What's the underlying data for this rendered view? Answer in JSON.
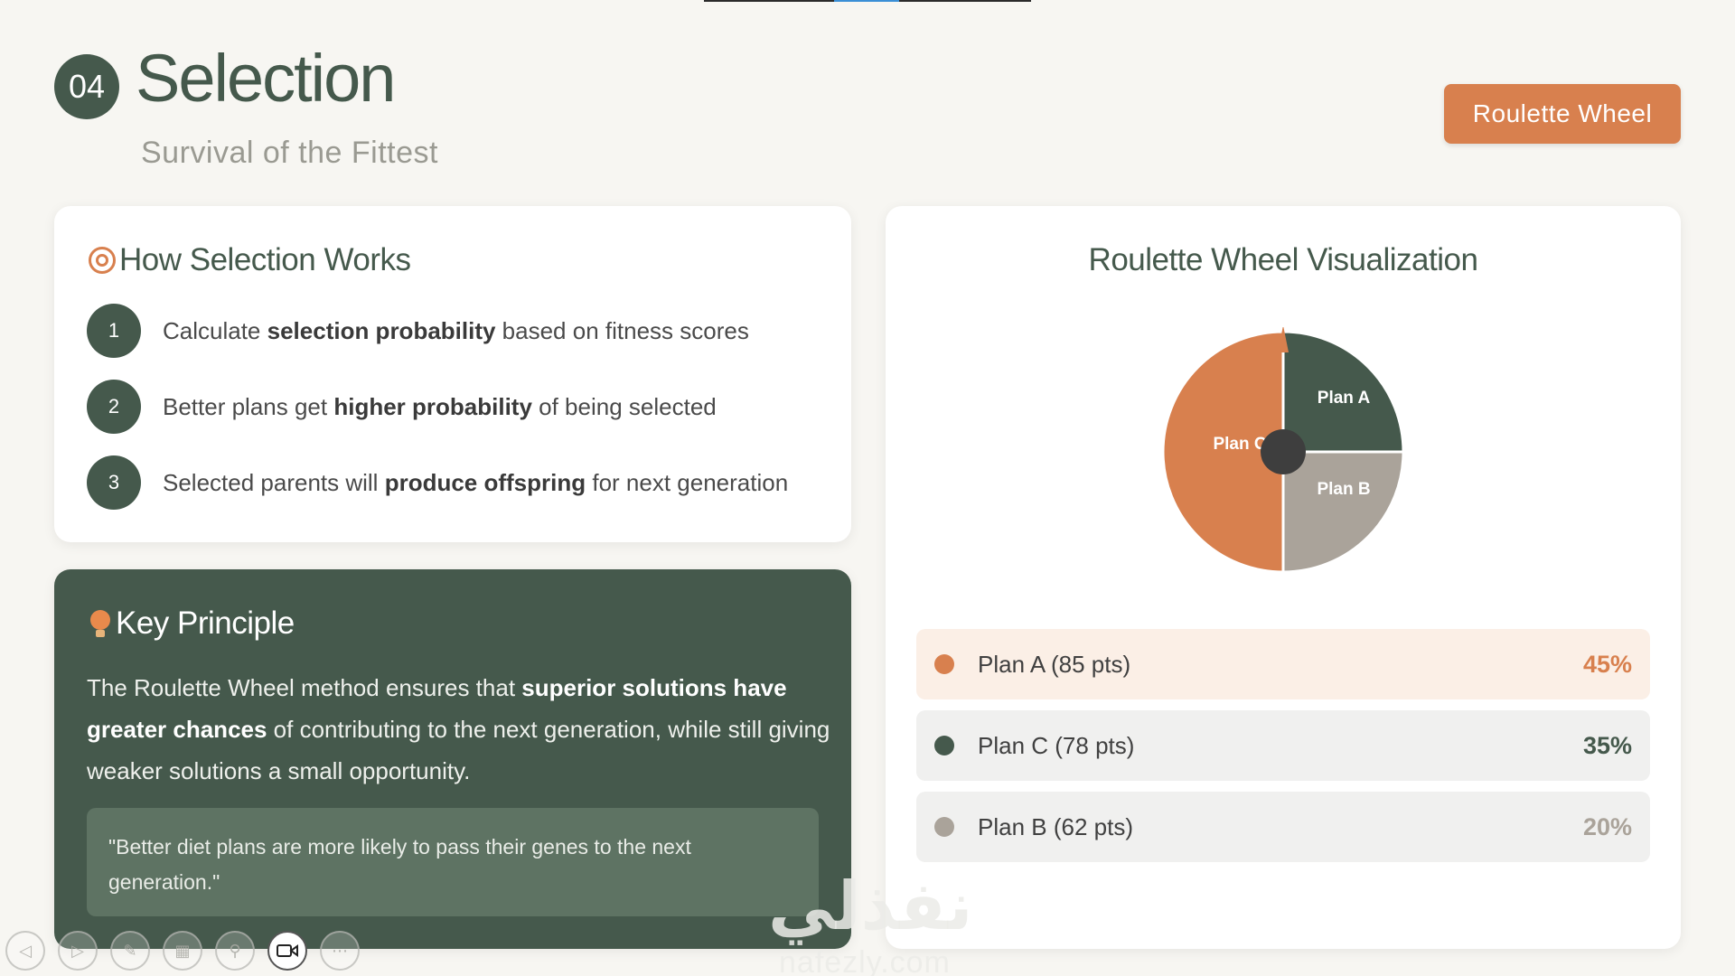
{
  "header": {
    "section_number": "04",
    "title": "Selection",
    "subtitle": "Survival of the Fittest",
    "badge_label": "Roulette Wheel"
  },
  "how_card": {
    "title": "How Selection Works",
    "icon": "target-icon",
    "steps": [
      {
        "num": "1",
        "pre": "Calculate ",
        "bold": "selection probability",
        "post": " based on fitness scores"
      },
      {
        "num": "2",
        "pre": "Better plans get ",
        "bold": "higher probability",
        "post": " of being selected"
      },
      {
        "num": "3",
        "pre": "Selected parents will ",
        "bold": "produce offspring",
        "post": " for next generation"
      }
    ]
  },
  "key_card": {
    "title": "Key Principle",
    "icon": "lightbulb-icon",
    "body_pre": "The Roulette Wheel method ensures that ",
    "body_bold": "superior solutions have greater chances",
    "body_post": " of contributing to the next generation, while still giving weaker solutions a small opportunity.",
    "quote": "\"Better diet plans are more likely to pass their genes to the next generation.\""
  },
  "viz_card": {
    "title": "Roulette Wheel Visualization",
    "wheel_labels": {
      "a": "Plan A",
      "b": "Plan B",
      "c": "Plan C"
    },
    "plans": [
      {
        "label": "Plan A (85 pts)",
        "percent": "45%",
        "color": "#d8804e",
        "pct_color": "#d8804e"
      },
      {
        "label": "Plan C (78 pts)",
        "percent": "35%",
        "color": "#45594c",
        "pct_color": "#45594c"
      },
      {
        "label": "Plan B (62 pts)",
        "percent": "20%",
        "color": "#aaa39a",
        "pct_color": "#aaa39a"
      }
    ]
  },
  "colors": {
    "primary": "#45594c",
    "accent": "#d8804e",
    "muted": "#aaa39a",
    "background": "#f7f6f2"
  },
  "watermark": {
    "arabic": "نفذلي",
    "latin": "nafezly.com"
  },
  "toolbar": {
    "icons": [
      "prev-arrow-icon",
      "next-arrow-icon",
      "pen-icon",
      "slides-grid-icon",
      "zoom-icon",
      "video-camera-icon",
      "more-options-icon"
    ]
  }
}
